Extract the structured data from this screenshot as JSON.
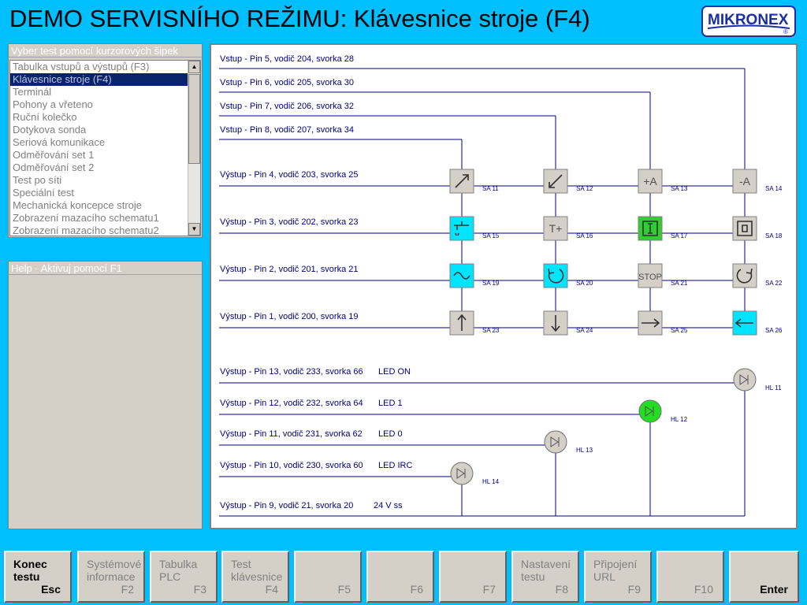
{
  "title": "DEMO SERVISNÍHO REŽIMU: Klávesnice stroje (F4)",
  "logo": {
    "text": "MIKRONEX",
    "mark": "®"
  },
  "test_panel": {
    "header": "Vyber test pomocí kurzorových šipek",
    "items": [
      "Tabulka vstupů a výstupů (F3)",
      "Klávesnice stroje (F4)",
      "Terminál",
      "Pohony a vřeteno",
      "Ruční kolečko",
      "Dotykova sonda",
      "Seriová komunikace",
      "Odměřování set 1",
      "Odměřování set 2",
      "Test po síti",
      "Speciální test",
      "Mechanická koncepce stroje",
      "Zobrazení mazacího schematu1",
      "Zobrazení mazacího schematu2"
    ],
    "selected_index": 1
  },
  "help_panel": {
    "header": "Help - Aktivuj pomocí F1"
  },
  "diagram": {
    "inputs": [
      "Vstup - Pin 5, vodič 204, svorka 28",
      "Vstup - Pin 6, vodič 205, svorka 30",
      "Vstup - Pin 7, vodič 206, svorka 32",
      "Vstup - Pin 8, vodič 207, svorka 34"
    ],
    "outputs": [
      "Výstup - Pin 4, vodič 203, svorka 25",
      "Výstup - Pin 3, vodič 202, svorka 23",
      "Výstup - Pin 2, vodič 201, svorka 21",
      "Výstup - Pin 1, vodič 200, svorka 19"
    ],
    "led_lines": [
      {
        "label": "Výstup - Pin 13, vodič 233, svorka 66",
        "name": "LED ON",
        "id": "HL 11",
        "state": "off"
      },
      {
        "label": "Výstup - Pin 12, vodič 232, svorka 64",
        "name": "LED 1",
        "id": "HL 12",
        "state": "on"
      },
      {
        "label": "Výstup - Pin 11, vodič 231, svorka 62",
        "name": "LED 0",
        "id": "HL 13",
        "state": "off"
      },
      {
        "label": "Výstup - Pin 10, vodič 230, svorka 60",
        "name": "LED IRC",
        "id": "HL 14",
        "state": "off"
      }
    ],
    "supply": {
      "label": "Výstup - Pin  9, vodič  21, svorka 20",
      "value": "24 V ss"
    },
    "keys": [
      [
        {
          "id": "SA 11",
          "icon": "arrow-up-right-icon",
          "state": "off"
        },
        {
          "id": "SA 12",
          "icon": "arrow-down-left-icon",
          "state": "off"
        },
        {
          "id": "SA 13",
          "icon": "+A",
          "state": "off"
        },
        {
          "id": "SA 14",
          "icon": "-A",
          "state": "off"
        }
      ],
      [
        {
          "id": "SA 15",
          "icon": "coolant-icon",
          "state": "cyan"
        },
        {
          "id": "SA 16",
          "icon": "T+",
          "state": "off"
        },
        {
          "id": "SA 17",
          "icon": "single-block-icon",
          "state": "green"
        },
        {
          "id": "SA 18",
          "icon": "optional-stop-icon",
          "state": "off"
        }
      ],
      [
        {
          "id": "SA 19",
          "icon": "wave-icon",
          "state": "cyan"
        },
        {
          "id": "SA 20",
          "icon": "spindle-ccw-icon",
          "state": "cyan"
        },
        {
          "id": "SA 21",
          "icon": "STOP",
          "state": "off"
        },
        {
          "id": "SA 22",
          "icon": "spindle-cw-icon",
          "state": "off"
        }
      ],
      [
        {
          "id": "SA 23",
          "icon": "arrow-up-icon",
          "state": "off"
        },
        {
          "id": "SA 24",
          "icon": "arrow-down-icon",
          "state": "off"
        },
        {
          "id": "SA 25",
          "icon": "arrow-right-icon",
          "state": "off"
        },
        {
          "id": "SA 26",
          "icon": "arrow-left-icon",
          "state": "cyan"
        }
      ]
    ]
  },
  "fkeys": [
    {
      "l1": "Konec",
      "l2": "testu",
      "key": "Esc",
      "active": true
    },
    {
      "l1": "Systémové",
      "l2": "informace",
      "key": "F2",
      "active": false
    },
    {
      "l1": "Tabulka",
      "l2": "PLC",
      "key": "F3",
      "active": false
    },
    {
      "l1": "Test",
      "l2": "klávesnice",
      "key": "F4",
      "active": false
    },
    {
      "l1": "",
      "l2": "",
      "key": "F5",
      "active": false
    },
    {
      "l1": "",
      "l2": "",
      "key": "F6",
      "active": false
    },
    {
      "l1": "",
      "l2": "",
      "key": "F7",
      "active": false
    },
    {
      "l1": "Nastavení",
      "l2": "testu",
      "key": "F8",
      "active": false
    },
    {
      "l1": "Připojení",
      "l2": "URL",
      "key": "F9",
      "active": false
    },
    {
      "l1": "",
      "l2": "",
      "key": "F10",
      "active": false
    },
    {
      "l1": "",
      "l2": "",
      "key": "Enter",
      "active": true
    }
  ],
  "colors": {
    "background": "#00bfff",
    "key_off": "#d4d0c8",
    "key_cyan": "#00e5ff",
    "key_green": "#33cc33",
    "led_on": "#22dd22",
    "wire": "#000080"
  }
}
